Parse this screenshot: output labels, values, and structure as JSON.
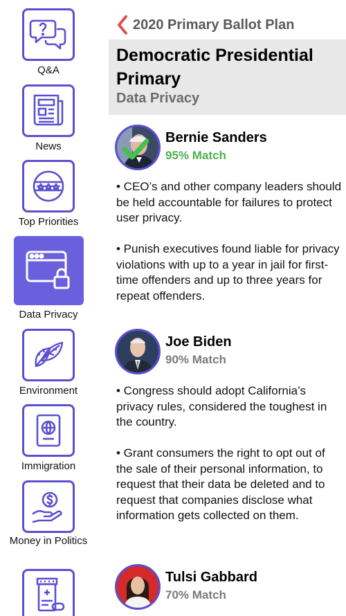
{
  "header": {
    "back_title": "2020 Primary Ballot Plan",
    "title": "Democratic Presidential Primary",
    "subtitle": "Data Privacy"
  },
  "sidebar": {
    "items": [
      {
        "label": "Q&A",
        "icon": "qa-bubbles-icon",
        "active": false
      },
      {
        "label": "News",
        "icon": "newspaper-icon",
        "active": false
      },
      {
        "label": "Top Priorities",
        "icon": "stars-badge-icon",
        "active": false
      },
      {
        "label": "Data Privacy",
        "icon": "browser-lock-icon",
        "active": true
      },
      {
        "label": "Environment",
        "icon": "leaves-icon",
        "active": false
      },
      {
        "label": "Immigration",
        "icon": "passport-icon",
        "active": false
      },
      {
        "label": "Money in Politics",
        "icon": "hand-coin-icon",
        "active": false
      },
      {
        "label": "",
        "icon": "medicine-bottle-icon",
        "active": false
      }
    ]
  },
  "candidates": [
    {
      "name": "Bernie Sanders",
      "match": "95% Match",
      "match_color": "#4caf50",
      "selected": true,
      "points": [
        "• CEO’s and other company leaders should be held accountable for failures to protect user privacy.",
        "• Punish executives found liable for privacy violations with up to a year in jail for first-time offenders and up to three years for repeat offenders."
      ]
    },
    {
      "name": "Joe Biden",
      "match": "90% Match",
      "match_color": "#7a7a7a",
      "selected": false,
      "points": [
        "• Congress should adopt California’s privacy rules, considered the toughest in the country.",
        "• Grant consumers the right to opt out of the sale of their personal information, to request that their data be deleted and to request that companies disclose what information gets collected on them."
      ]
    },
    {
      "name": "Tulsi Gabbard",
      "match": "70% Match",
      "match_color": "#7a7a7a",
      "selected": false,
      "points": []
    }
  ],
  "colors": {
    "accent": "#5b4fd0",
    "active_bg": "#6a5fdc",
    "back_chevron": "#d9534f",
    "title_bg": "#e8e8e8"
  }
}
